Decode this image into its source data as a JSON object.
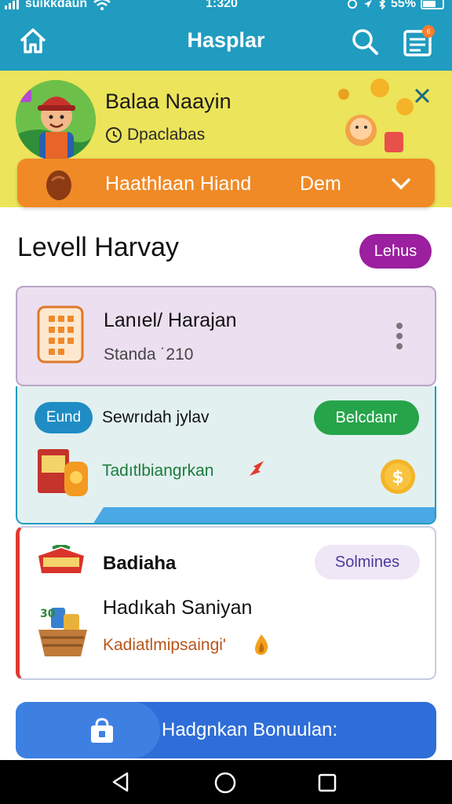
{
  "status_bar": {
    "carrier": "suıkkdaun",
    "time": "1:320",
    "battery": "55%"
  },
  "header": {
    "title": "Hasplar",
    "cart_badge": "6"
  },
  "banner": {
    "name": "Balaa Naayin",
    "subtitle": "Dpaclabas",
    "promo_label": "Haathlaan Hiand",
    "promo_label2": "Dem"
  },
  "section": {
    "title": "Levell Harvay",
    "pill": "Lehus"
  },
  "cards": [
    {
      "title": "Lanıel/ Harajan",
      "subtitle": "Standa ˙210"
    },
    {
      "tag": "Eund",
      "title": "Sewrıdah jylav",
      "button": "Belcdanr",
      "subtitle": "Tadıtlbiangrkan"
    },
    {
      "title": "Badiaha",
      "chip": "Solmines",
      "title2": "Hadıkah Saniyan",
      "subtitle": "Kadiatlmipsaingi'"
    }
  ],
  "cta": {
    "label": "Hadgnkan Bonuulan:"
  },
  "colors": {
    "brand": "#1f9cc0",
    "banner": "#ece45a",
    "promo": "#f08a26",
    "pill": "#9b1f9e",
    "accent_green": "#26a44a",
    "cta": "#2f6ed8"
  }
}
